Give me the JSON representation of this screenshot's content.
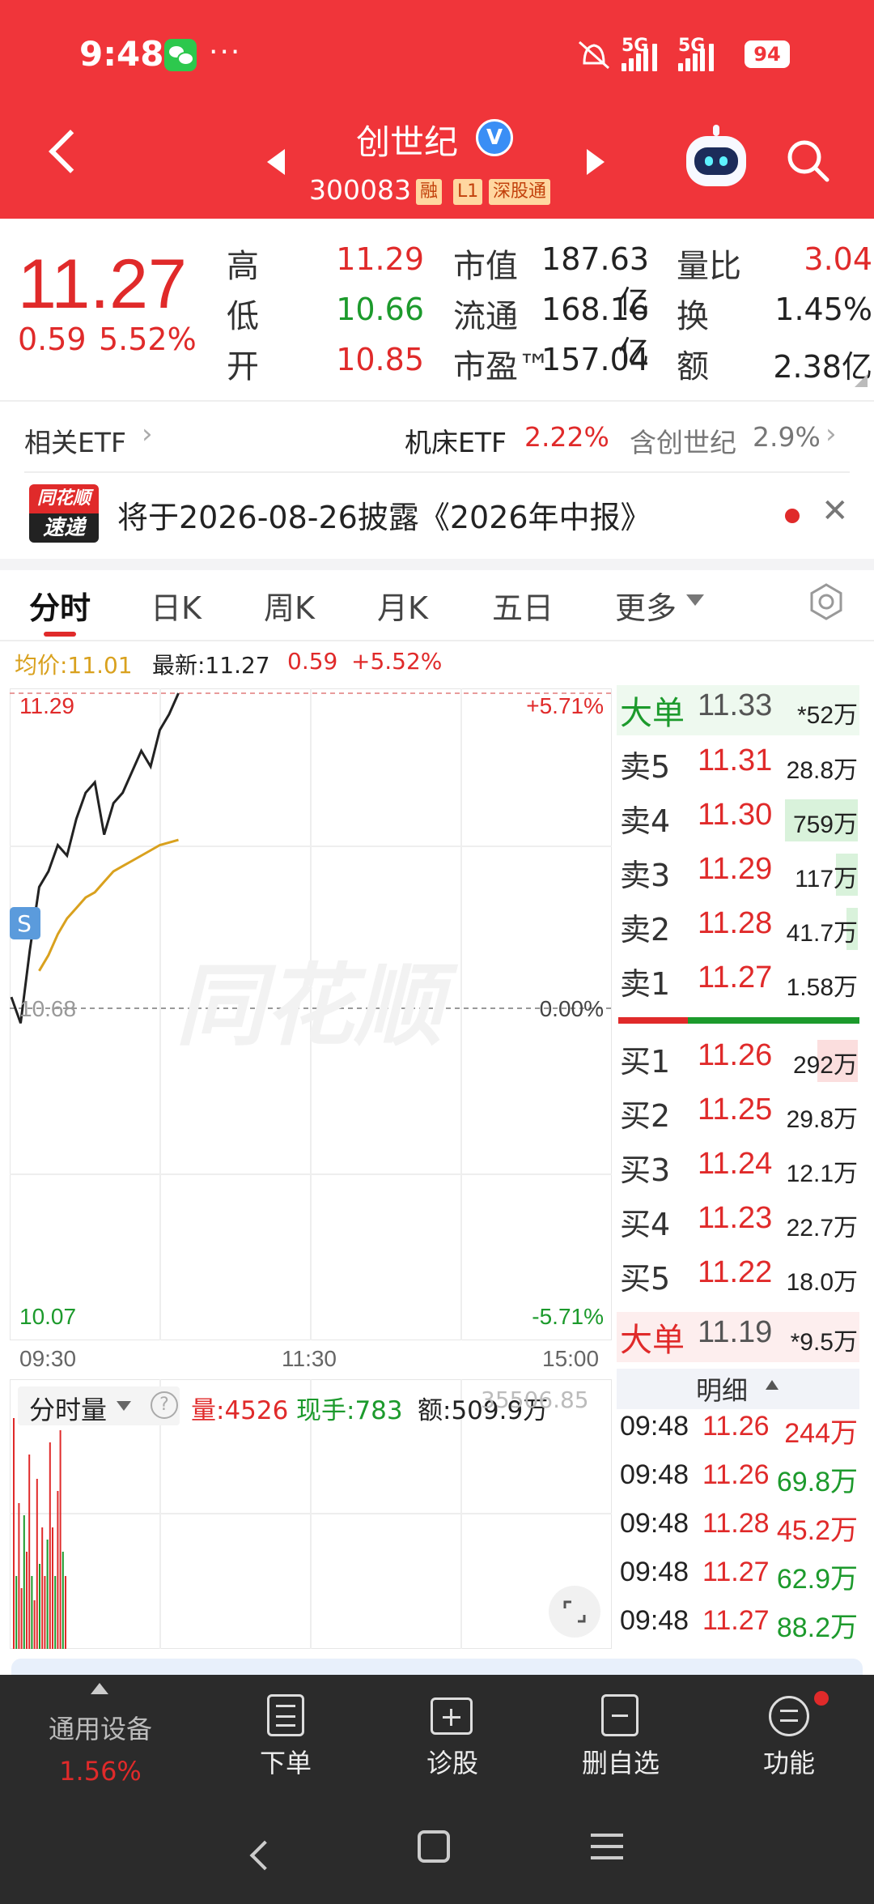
{
  "status": {
    "time": "9:48",
    "more": "···",
    "net1": "5G",
    "net2": "5G",
    "battery": "94"
  },
  "header": {
    "name": "创世纪",
    "verified": "V",
    "code": "300083",
    "tags": [
      "融",
      "L1",
      "深股通"
    ]
  },
  "quote": {
    "price": "11.27",
    "change": "0.59",
    "change_pct": "5.52%",
    "rows": [
      {
        "l1": "高",
        "v1": "11.29",
        "l2": "市值",
        "v2": "187.63亿",
        "l3": "量比",
        "v3": "3.04"
      },
      {
        "l1": "低",
        "v1": "10.66",
        "l2": "流通",
        "v2": "168.16亿",
        "l3": "换",
        "v3": "1.45%"
      },
      {
        "l1": "开",
        "v1": "10.85",
        "l2": "市盈™",
        "v2": "157.04",
        "l3": "额",
        "v3": "2.38亿"
      }
    ]
  },
  "etf": {
    "label": "相关ETF",
    "name": "机床ETF",
    "pct": "2.22%",
    "contain_label": "含创世纪",
    "contain_pct": "2.9%"
  },
  "notice": {
    "logo_top": "同花顺",
    "logo_bottom": "速递",
    "text": "将于2026-08-26披露《2026年中报》"
  },
  "tabs": [
    "分时",
    "日K",
    "周K",
    "月K",
    "五日",
    "更多"
  ],
  "chart_info": {
    "avg": "均价:11.01",
    "latest": "最新:11.27",
    "chg": "0.59",
    "pct": "+5.52%"
  },
  "chart_data": {
    "type": "line",
    "x_ticks": [
      "09:30",
      "11:30",
      "15:00"
    ],
    "y_left": {
      "top": "11.29",
      "mid": "10.68",
      "bottom": "10.07"
    },
    "y_right": {
      "top": "+5.71%",
      "mid": "0.00%",
      "bottom": "-5.71%"
    },
    "ylim": [
      10.07,
      11.29
    ],
    "series": [
      {
        "color": "#222222",
        "x": [
          0,
          1,
          2,
          3,
          4,
          5,
          6,
          7,
          8,
          9,
          10,
          11,
          12,
          13,
          14,
          15,
          16,
          17,
          18
        ],
        "values": [
          10.71,
          10.66,
          10.8,
          10.92,
          10.95,
          11.0,
          10.98,
          11.05,
          11.1,
          11.12,
          11.02,
          11.08,
          11.1,
          11.14,
          11.18,
          11.15,
          11.22,
          11.25,
          11.29
        ]
      },
      {
        "color": "#d9a11e",
        "x": [
          3,
          4,
          5,
          6,
          7,
          8,
          9,
          10,
          11,
          12,
          13,
          14,
          15,
          16,
          17,
          18
        ],
        "values": [
          10.76,
          10.79,
          10.83,
          10.86,
          10.88,
          10.9,
          10.91,
          10.93,
          10.95,
          10.96,
          10.97,
          10.98,
          10.99,
          11.0,
          11.005,
          11.01
        ]
      }
    ],
    "volume_bars": [
      0.95,
      0.3,
      0.6,
      0.25,
      0.55,
      0.4,
      0.8,
      0.3,
      0.2,
      0.7,
      0.35,
      0.5,
      0.3,
      0.45,
      0.85,
      0.5,
      0.3,
      0.65,
      0.9,
      0.4,
      0.3
    ],
    "watermark": "同花顺",
    "s_marker": "S"
  },
  "volume_info": {
    "label": "分时量",
    "help": "?",
    "vol": "量:4526",
    "hand": "现手:783",
    "amount": "额:509.9万",
    "right": "35506.85"
  },
  "orderbook": {
    "big_top": {
      "label": "大单",
      "price": "11.33",
      "vol": "*52万"
    },
    "asks": [
      {
        "label": "卖5",
        "price": "11.31",
        "vol": "28.8万"
      },
      {
        "label": "卖4",
        "price": "11.30",
        "vol": "759万"
      },
      {
        "label": "卖3",
        "price": "11.29",
        "vol": "117万"
      },
      {
        "label": "卖2",
        "price": "11.28",
        "vol": "41.7万"
      },
      {
        "label": "卖1",
        "price": "11.27",
        "vol": "1.58万"
      }
    ],
    "bids": [
      {
        "label": "买1",
        "price": "11.26",
        "vol": "292万"
      },
      {
        "label": "买2",
        "price": "11.25",
        "vol": "29.8万"
      },
      {
        "label": "买3",
        "price": "11.24",
        "vol": "12.1万"
      },
      {
        "label": "买4",
        "price": "11.23",
        "vol": "22.7万"
      },
      {
        "label": "买5",
        "price": "11.22",
        "vol": "18.0万"
      }
    ],
    "big_bottom": {
      "label": "大单",
      "price": "11.19",
      "vol": "*9.5万"
    }
  },
  "detail": {
    "header": "明细",
    "rows": [
      {
        "time": "09:48",
        "price": "11.26",
        "vol": "244万"
      },
      {
        "time": "09:48",
        "price": "11.26",
        "vol": "69.8万"
      },
      {
        "time": "09:48",
        "price": "11.28",
        "vol": "45.2万"
      },
      {
        "time": "09:48",
        "price": "11.27",
        "vol": "62.9万"
      },
      {
        "time": "09:48",
        "price": "11.27",
        "vol": "88.2万"
      }
    ]
  },
  "bottom": {
    "sector": "通用设备",
    "sector_pct": "1.56%",
    "nav": [
      "下单",
      "诊股",
      "删自选",
      "功能"
    ]
  }
}
